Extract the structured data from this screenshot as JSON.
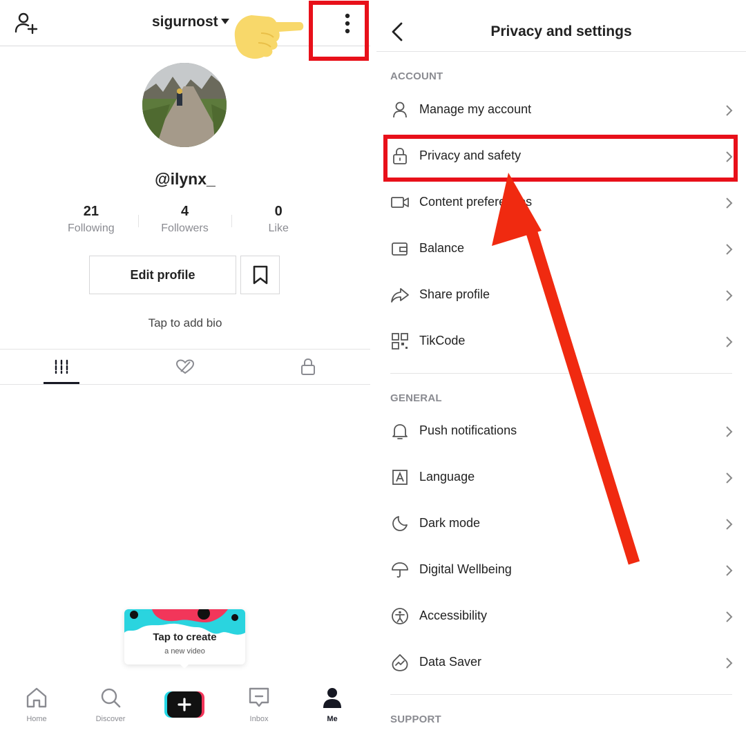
{
  "profile": {
    "username": "sigurnost",
    "handle": "@ilynx_",
    "stats": [
      {
        "value": "21",
        "label": "Following"
      },
      {
        "value": "4",
        "label": "Followers"
      },
      {
        "value": "0",
        "label": "Like"
      }
    ],
    "edit_profile_label": "Edit profile",
    "bio_prompt": "Tap to add bio",
    "tooltip": {
      "title": "Tap to create",
      "subtitle": "a new video"
    },
    "nav": [
      {
        "label": "Home",
        "icon": "home-icon"
      },
      {
        "label": "Discover",
        "icon": "search-icon"
      },
      {
        "label": "Inbox",
        "icon": "inbox-icon"
      },
      {
        "label": "Me",
        "icon": "user-icon"
      }
    ]
  },
  "settings": {
    "title": "Privacy and settings",
    "sections": [
      {
        "label": "ACCOUNT",
        "items": [
          {
            "label": "Manage my account",
            "icon": "person-icon"
          },
          {
            "label": "Privacy and safety",
            "icon": "lock-icon"
          },
          {
            "label": "Content preferences",
            "icon": "video-icon"
          },
          {
            "label": "Balance",
            "icon": "wallet-icon"
          },
          {
            "label": "Share profile",
            "icon": "share-icon"
          },
          {
            "label": "TikCode",
            "icon": "qr-code-icon"
          }
        ]
      },
      {
        "label": "GENERAL",
        "items": [
          {
            "label": "Push notifications",
            "icon": "bell-icon"
          },
          {
            "label": "Language",
            "icon": "language-icon"
          },
          {
            "label": "Dark mode",
            "icon": "moon-icon"
          },
          {
            "label": "Digital Wellbeing",
            "icon": "umbrella-icon"
          },
          {
            "label": "Accessibility",
            "icon": "accessibility-icon"
          },
          {
            "label": "Data Saver",
            "icon": "data-saver-icon"
          }
        ]
      },
      {
        "label": "SUPPORT",
        "items": []
      }
    ]
  },
  "colors": {
    "highlight": "#e8101a",
    "text_primary": "#161823",
    "text_secondary": "#8a8b91",
    "hand": "#f8d86a"
  }
}
